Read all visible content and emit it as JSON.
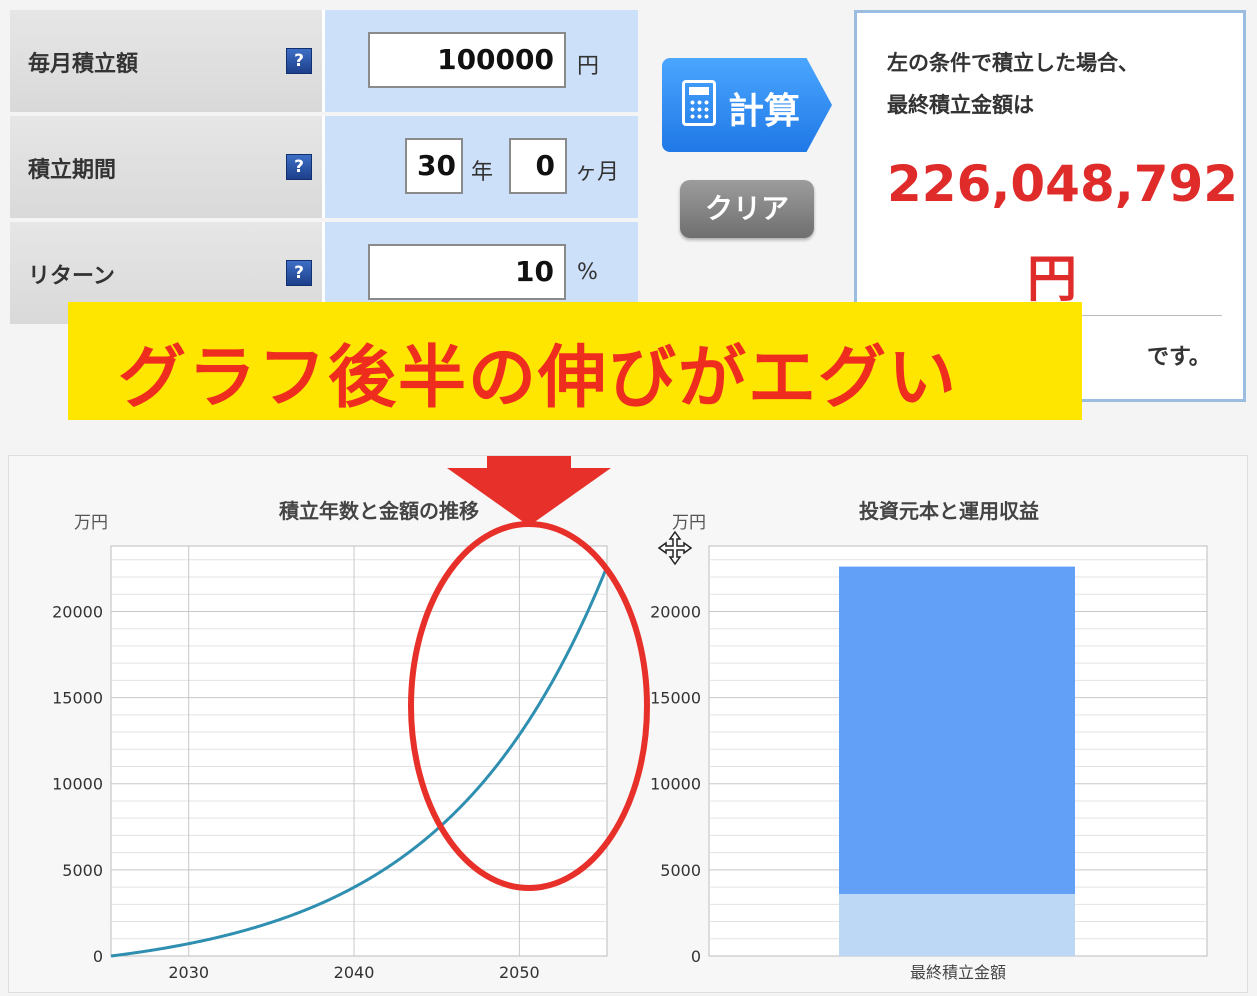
{
  "form": {
    "rows": [
      {
        "label": "毎月積立額",
        "value": "100000",
        "unit": "円"
      },
      {
        "label": "積立期間",
        "years": "30",
        "years_unit": "年",
        "months": "0",
        "months_unit": "ヶ月"
      },
      {
        "label": "リターン",
        "value": "10",
        "unit": "%"
      }
    ],
    "help_icon": "?"
  },
  "buttons": {
    "calculate": "計算",
    "clear": "クリア"
  },
  "result": {
    "line1": "左の条件で積立した場合、",
    "line2": "最終積立金額は",
    "amount": "226,048,792",
    "currency": "円",
    "suffix": "です。"
  },
  "banner": {
    "text": "グラフ後半の伸びがエグい"
  },
  "colors": {
    "annotation_red": "#e8302a",
    "banner_yellow": "#ffe600",
    "line": "#2f8fb0",
    "bar_principal": "#bcd8f4",
    "bar_return": "#629ff7",
    "result_red": "#e02b2b"
  },
  "chart_data": [
    {
      "type": "line",
      "title": "積立年数と金額の推移",
      "ylabel": "万円",
      "xlabel": "",
      "x_ticks": [
        2030,
        2040,
        2050
      ],
      "xlim": [
        2025.3,
        2055.3
      ],
      "y_ticks": [
        0,
        5000,
        10000,
        15000,
        20000
      ],
      "ylim": [
        0,
        23800
      ],
      "monthly_contribution": 10,
      "annual_return": 0.1,
      "x": [
        2025.3,
        2030.3,
        2035.3,
        2040.3,
        2045.3,
        2050.3,
        2055.3
      ],
      "y": [
        0,
        777,
        2066,
        4144,
        7596,
        13362,
        22605
      ]
    },
    {
      "type": "bar",
      "title": "投資元本と運用収益",
      "ylabel": "万円",
      "categories": [
        "最終積立金額"
      ],
      "y_ticks": [
        0,
        5000,
        10000,
        15000,
        20000
      ],
      "ylim": [
        0,
        23800
      ],
      "series": [
        {
          "values": [
            3600
          ]
        },
        {
          "values": [
            19005
          ]
        }
      ]
    }
  ]
}
